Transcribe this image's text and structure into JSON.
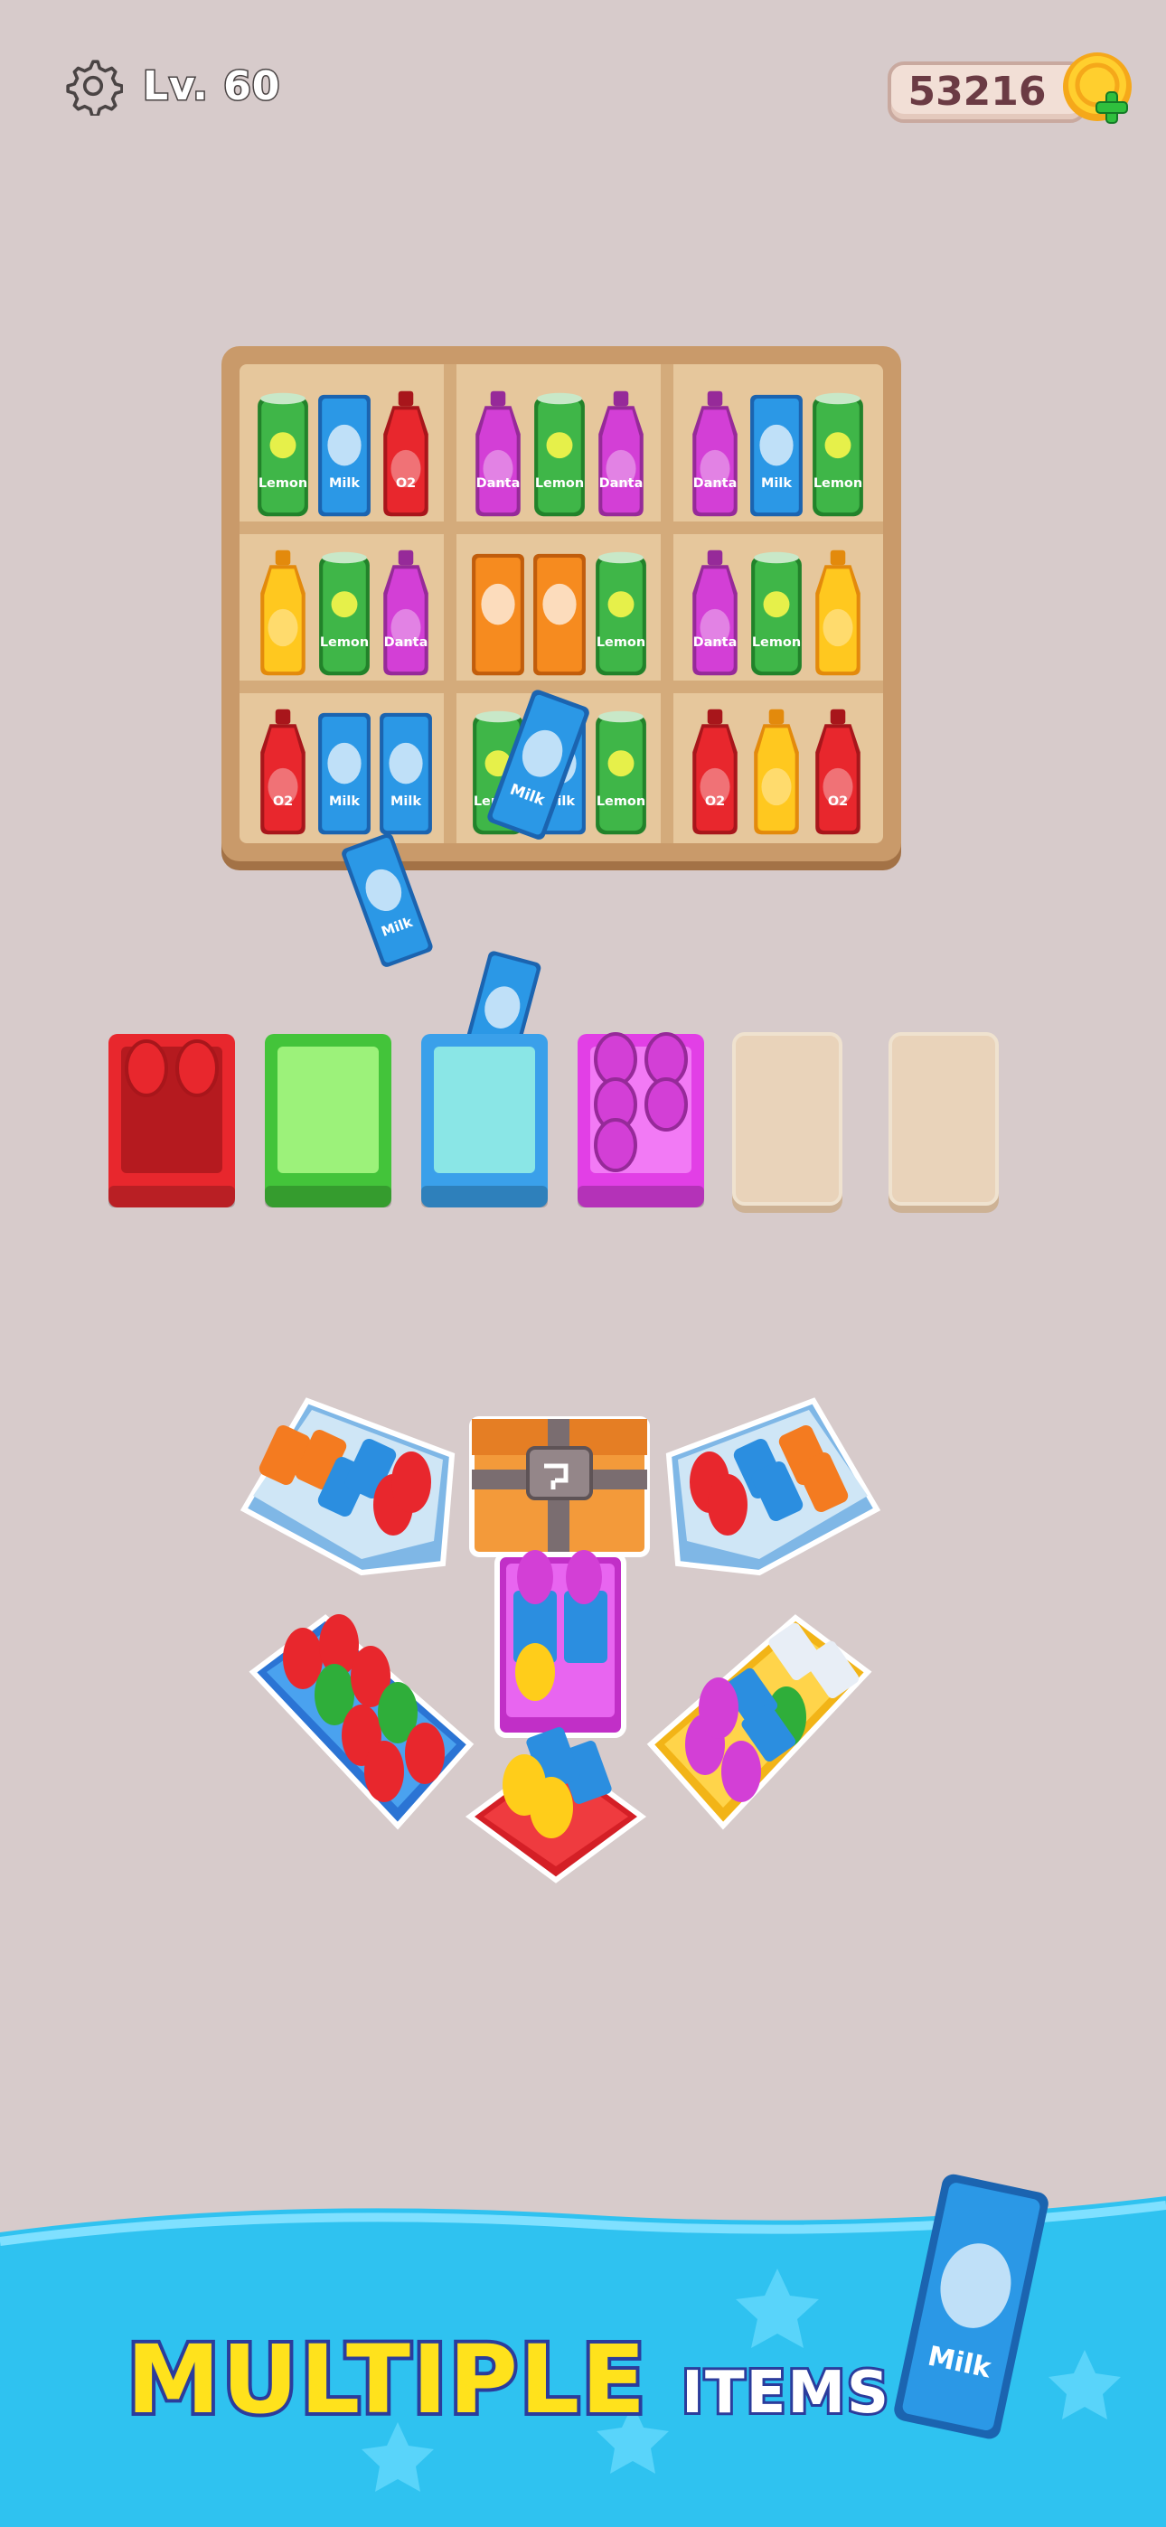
{
  "hud": {
    "level_label": "Lv. 60",
    "coins": "53216"
  },
  "shelf_items": [
    [
      "lemon",
      "milk",
      "o2",
      "danta",
      "lemon",
      "danta",
      "danta",
      "milk",
      "lemon"
    ],
    [
      "pineapple",
      "lemon",
      "danta",
      "orange",
      "orange",
      "lemon",
      "danta",
      "lemon",
      "pineapple"
    ],
    [
      "o2",
      "milk",
      "milk",
      "lemon",
      "milk",
      "lemon",
      "o2",
      "pineapple",
      "o2"
    ]
  ],
  "item_labels": {
    "lemon": "Lemon",
    "milk": "Milk",
    "o2": "O2",
    "danta": "Danta",
    "orange": "",
    "pineapple": ""
  },
  "slots": [
    {
      "color": "red",
      "filled": true
    },
    {
      "color": "green",
      "filled": false
    },
    {
      "color": "blue",
      "filled": false
    },
    {
      "color": "magenta",
      "filled": true
    },
    {
      "color": "empty",
      "filled": false
    },
    {
      "color": "empty",
      "filled": false
    }
  ],
  "banner": {
    "big": "MULTIPLE",
    "small": "ITEMS"
  },
  "colors": {
    "background": "#d7cbcb",
    "banner": "#2fc2f0",
    "accent_yellow": "#ffe21c",
    "outline_blue": "#2b3c9c"
  }
}
